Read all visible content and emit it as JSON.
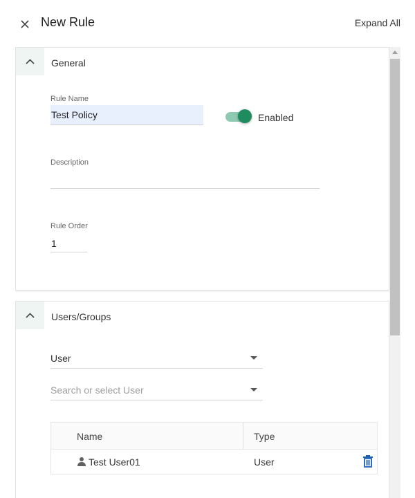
{
  "header": {
    "title": "New Rule",
    "expand_all": "Expand All"
  },
  "general": {
    "section_title": "General",
    "rule_name_label": "Rule Name",
    "rule_name_value": "Test Policy",
    "enabled": true,
    "enabled_label": "Enabled",
    "description_label": "Description",
    "description_value": "",
    "rule_order_label": "Rule Order",
    "rule_order_value": "1"
  },
  "users_groups": {
    "section_title": "Users/Groups",
    "type_select_value": "User",
    "search_placeholder": "Search or select User",
    "table": {
      "columns": [
        "Name",
        "Type"
      ],
      "rows": [
        {
          "name": "Test User01",
          "type": "User"
        }
      ]
    }
  },
  "colors": {
    "accent": "#1e8c5f",
    "toggle_track": "#8ec9b2",
    "autofill_bg": "#e8f0fe",
    "delete_icon": "#1a5fb4"
  }
}
